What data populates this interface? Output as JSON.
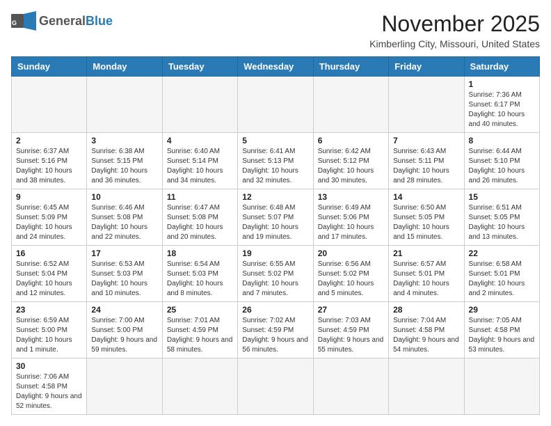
{
  "header": {
    "logo_general": "General",
    "logo_blue": "Blue",
    "month": "November 2025",
    "location": "Kimberling City, Missouri, United States"
  },
  "weekdays": [
    "Sunday",
    "Monday",
    "Tuesday",
    "Wednesday",
    "Thursday",
    "Friday",
    "Saturday"
  ],
  "weeks": [
    [
      {
        "day": "",
        "info": ""
      },
      {
        "day": "",
        "info": ""
      },
      {
        "day": "",
        "info": ""
      },
      {
        "day": "",
        "info": ""
      },
      {
        "day": "",
        "info": ""
      },
      {
        "day": "",
        "info": ""
      },
      {
        "day": "1",
        "info": "Sunrise: 7:36 AM\nSunset: 6:17 PM\nDaylight: 10 hours and 40 minutes."
      }
    ],
    [
      {
        "day": "2",
        "info": "Sunrise: 6:37 AM\nSunset: 5:16 PM\nDaylight: 10 hours and 38 minutes."
      },
      {
        "day": "3",
        "info": "Sunrise: 6:38 AM\nSunset: 5:15 PM\nDaylight: 10 hours and 36 minutes."
      },
      {
        "day": "4",
        "info": "Sunrise: 6:40 AM\nSunset: 5:14 PM\nDaylight: 10 hours and 34 minutes."
      },
      {
        "day": "5",
        "info": "Sunrise: 6:41 AM\nSunset: 5:13 PM\nDaylight: 10 hours and 32 minutes."
      },
      {
        "day": "6",
        "info": "Sunrise: 6:42 AM\nSunset: 5:12 PM\nDaylight: 10 hours and 30 minutes."
      },
      {
        "day": "7",
        "info": "Sunrise: 6:43 AM\nSunset: 5:11 PM\nDaylight: 10 hours and 28 minutes."
      },
      {
        "day": "8",
        "info": "Sunrise: 6:44 AM\nSunset: 5:10 PM\nDaylight: 10 hours and 26 minutes."
      }
    ],
    [
      {
        "day": "9",
        "info": "Sunrise: 6:45 AM\nSunset: 5:09 PM\nDaylight: 10 hours and 24 minutes."
      },
      {
        "day": "10",
        "info": "Sunrise: 6:46 AM\nSunset: 5:08 PM\nDaylight: 10 hours and 22 minutes."
      },
      {
        "day": "11",
        "info": "Sunrise: 6:47 AM\nSunset: 5:08 PM\nDaylight: 10 hours and 20 minutes."
      },
      {
        "day": "12",
        "info": "Sunrise: 6:48 AM\nSunset: 5:07 PM\nDaylight: 10 hours and 19 minutes."
      },
      {
        "day": "13",
        "info": "Sunrise: 6:49 AM\nSunset: 5:06 PM\nDaylight: 10 hours and 17 minutes."
      },
      {
        "day": "14",
        "info": "Sunrise: 6:50 AM\nSunset: 5:05 PM\nDaylight: 10 hours and 15 minutes."
      },
      {
        "day": "15",
        "info": "Sunrise: 6:51 AM\nSunset: 5:05 PM\nDaylight: 10 hours and 13 minutes."
      }
    ],
    [
      {
        "day": "16",
        "info": "Sunrise: 6:52 AM\nSunset: 5:04 PM\nDaylight: 10 hours and 12 minutes."
      },
      {
        "day": "17",
        "info": "Sunrise: 6:53 AM\nSunset: 5:03 PM\nDaylight: 10 hours and 10 minutes."
      },
      {
        "day": "18",
        "info": "Sunrise: 6:54 AM\nSunset: 5:03 PM\nDaylight: 10 hours and 8 minutes."
      },
      {
        "day": "19",
        "info": "Sunrise: 6:55 AM\nSunset: 5:02 PM\nDaylight: 10 hours and 7 minutes."
      },
      {
        "day": "20",
        "info": "Sunrise: 6:56 AM\nSunset: 5:02 PM\nDaylight: 10 hours and 5 minutes."
      },
      {
        "day": "21",
        "info": "Sunrise: 6:57 AM\nSunset: 5:01 PM\nDaylight: 10 hours and 4 minutes."
      },
      {
        "day": "22",
        "info": "Sunrise: 6:58 AM\nSunset: 5:01 PM\nDaylight: 10 hours and 2 minutes."
      }
    ],
    [
      {
        "day": "23",
        "info": "Sunrise: 6:59 AM\nSunset: 5:00 PM\nDaylight: 10 hours and 1 minute."
      },
      {
        "day": "24",
        "info": "Sunrise: 7:00 AM\nSunset: 5:00 PM\nDaylight: 9 hours and 59 minutes."
      },
      {
        "day": "25",
        "info": "Sunrise: 7:01 AM\nSunset: 4:59 PM\nDaylight: 9 hours and 58 minutes."
      },
      {
        "day": "26",
        "info": "Sunrise: 7:02 AM\nSunset: 4:59 PM\nDaylight: 9 hours and 56 minutes."
      },
      {
        "day": "27",
        "info": "Sunrise: 7:03 AM\nSunset: 4:59 PM\nDaylight: 9 hours and 55 minutes."
      },
      {
        "day": "28",
        "info": "Sunrise: 7:04 AM\nSunset: 4:58 PM\nDaylight: 9 hours and 54 minutes."
      },
      {
        "day": "29",
        "info": "Sunrise: 7:05 AM\nSunset: 4:58 PM\nDaylight: 9 hours and 53 minutes."
      }
    ],
    [
      {
        "day": "30",
        "info": "Sunrise: 7:06 AM\nSunset: 4:58 PM\nDaylight: 9 hours and 52 minutes."
      },
      {
        "day": "",
        "info": ""
      },
      {
        "day": "",
        "info": ""
      },
      {
        "day": "",
        "info": ""
      },
      {
        "day": "",
        "info": ""
      },
      {
        "day": "",
        "info": ""
      },
      {
        "day": "",
        "info": ""
      }
    ]
  ]
}
